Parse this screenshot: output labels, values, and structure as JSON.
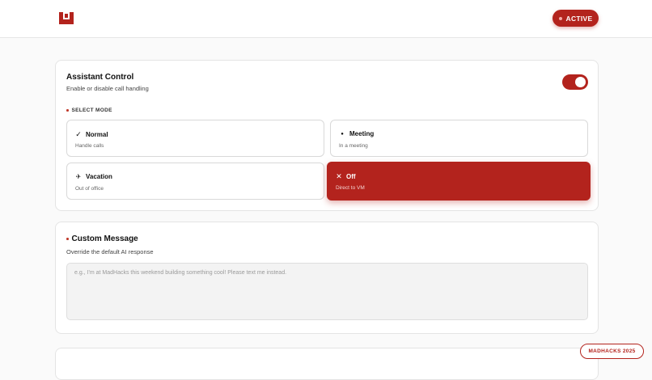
{
  "header": {
    "logo_icon": "madhacks-logo-icon",
    "status_label": "ACTIVE",
    "status_dot_icon": "status-dot-icon"
  },
  "colors": {
    "accent": "#b3231d",
    "background": "#fafafa"
  },
  "assistant_control": {
    "title": "Assistant Control",
    "subtitle": "Enable or disable call handling",
    "toggle_on": true,
    "select_mode_label": "SELECT MODE",
    "modes": [
      {
        "icon": "checkmark-icon",
        "glyph": "✓",
        "label": "Normal",
        "desc": "Handle calls",
        "selected": false
      },
      {
        "icon": "dot-icon",
        "glyph": "●",
        "label": "Meeting",
        "desc": "In a meeting",
        "selected": false
      },
      {
        "icon": "airplane-icon",
        "glyph": "✈",
        "label": "Vacation",
        "desc": "Out of office",
        "selected": false
      },
      {
        "icon": "close-icon",
        "glyph": "✕",
        "label": "Off",
        "desc": "Direct to VM",
        "selected": true
      }
    ]
  },
  "custom_message": {
    "title": "Custom Message",
    "subtitle": "Override the default AI response",
    "placeholder": "e.g., I'm at MadHacks this weekend building something cool! Please text me instead.",
    "value": ""
  },
  "badge": {
    "label": "MADHACKS 2025"
  }
}
